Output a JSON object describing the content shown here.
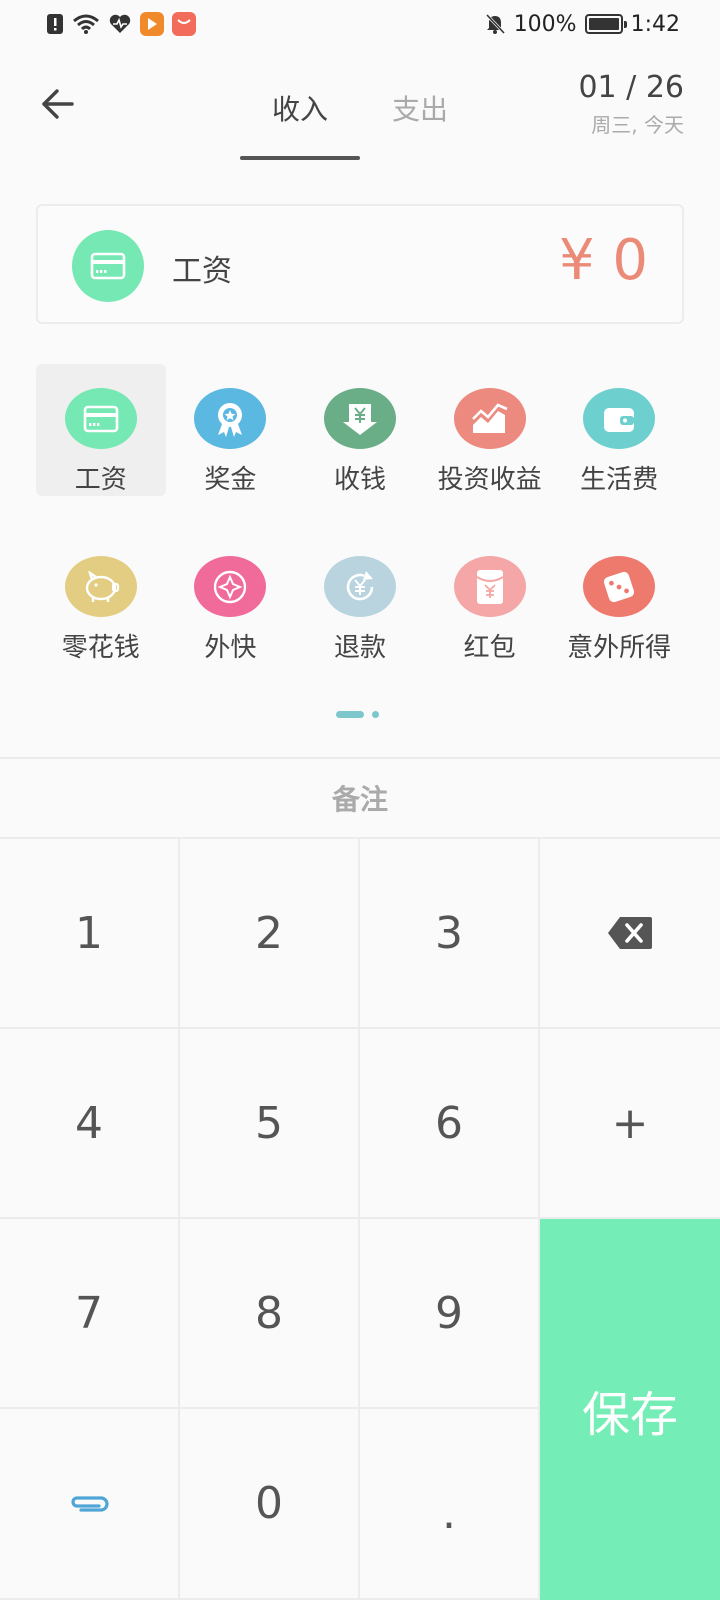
{
  "status_bar": {
    "battery": "100%",
    "time": "1:42",
    "icons": [
      "alert-icon",
      "wifi-icon",
      "heart-icon",
      "app-badge-orange",
      "app-badge-red",
      "mute-icon",
      "battery-icon"
    ]
  },
  "header": {
    "tabs": [
      {
        "label": "收入",
        "active": true
      },
      {
        "label": "支出",
        "active": false
      }
    ],
    "date": "01 / 26",
    "date_sub": "周三, 今天"
  },
  "amount_card": {
    "category": "工资",
    "amount": "¥ 0",
    "color": "#75e8b3"
  },
  "categories": {
    "rows": [
      [
        {
          "label": "工资",
          "icon": "card-icon",
          "color": "#75e8b3",
          "selected": true
        },
        {
          "label": "奖金",
          "icon": "medal-icon",
          "color": "#5bb8e0"
        },
        {
          "label": "收钱",
          "icon": "yuan-down-icon",
          "color": "#6aae88"
        },
        {
          "label": "投资收益",
          "icon": "chart-icon",
          "color": "#ec8a7f"
        },
        {
          "label": "生活费",
          "icon": "wallet-icon",
          "color": "#6ecfcf"
        }
      ],
      [
        {
          "label": "零花钱",
          "icon": "piggy-icon",
          "color": "#e3cd82"
        },
        {
          "label": "外快",
          "icon": "compass-icon",
          "color": "#f06a9a"
        },
        {
          "label": "退款",
          "icon": "refund-icon",
          "color": "#b9d4de"
        },
        {
          "label": "红包",
          "icon": "red-envelope-icon",
          "color": "#f5a6a6"
        },
        {
          "label": "意外所得",
          "icon": "dice-icon",
          "color": "#ee7a6e"
        }
      ]
    ]
  },
  "note": {
    "label": "备注"
  },
  "keypad": {
    "k1": "1",
    "k2": "2",
    "k3": "3",
    "k4": "4",
    "k5": "5",
    "k6": "6",
    "k7": "7",
    "k8": "8",
    "k9": "9",
    "k0": "0",
    "dot": ".",
    "plus": "+",
    "save": "保存"
  }
}
